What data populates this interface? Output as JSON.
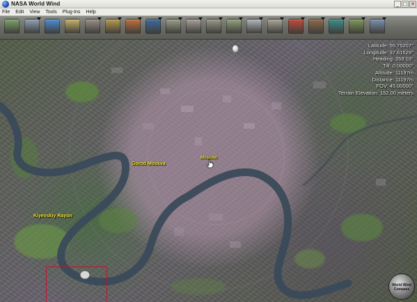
{
  "window": {
    "title": "NASA World Wind",
    "minimize_glyph": "_",
    "maximize_glyph": "▢",
    "close_glyph": "✕"
  },
  "menu": [
    "File",
    "Edit",
    "View",
    "Tools",
    "Plug-Ins",
    "Help"
  ],
  "toolbar": {
    "buttons": [
      {
        "name": "satellite-tool-icon",
        "color": "#7da36b"
      },
      {
        "name": "grid-tool-icon",
        "color": "#8fa1b6"
      },
      {
        "name": "globe-tool-icon",
        "color": "#4c8cd8"
      },
      {
        "name": "search-tool-icon",
        "color": "#c7b36a"
      },
      {
        "name": "layer-manager-icon",
        "color": "#9a8f86"
      },
      {
        "name": "landsat-layer-icon",
        "color": "#b89a4e"
      },
      {
        "name": "weather-layer-icon",
        "color": "#c0713a"
      },
      {
        "name": "bluemarble-layer-icon",
        "color": "#3e6a9e"
      },
      {
        "name": "usgs-topo-icon",
        "color": "#9aa08a"
      },
      {
        "name": "usgs-urban-icon",
        "color": "#a8a298"
      },
      {
        "name": "usgs-ortho-icon",
        "color": "#9c9a8c"
      },
      {
        "name": "zoomit-layer-icon",
        "color": "#93a37b"
      },
      {
        "name": "places-layer-icon",
        "color": "#b0b6bd"
      },
      {
        "name": "boundaries-layer-icon",
        "color": "#aaa69a"
      },
      {
        "name": "flag-layer-icon",
        "color": "#c24a3a"
      },
      {
        "name": "landmarks-layer-icon",
        "color": "#8f6a4a"
      },
      {
        "name": "atmosphere-layer-icon",
        "color": "#3b8f8a"
      },
      {
        "name": "terrain-layer-icon",
        "color": "#7f9a5a"
      },
      {
        "name": "scale-bar-icon",
        "color": "#7a90b0"
      }
    ]
  },
  "overlay": {
    "latitude": "Latitude: 55.75207°",
    "longitude": "Longitude: 37.61529°",
    "heading": "Heading: 359.03°",
    "tilt": "Tilt: 0.00000°",
    "altitude": "Altitude: 11197m",
    "distance": "Distance: 11197m",
    "fov": "FOV: 45.00000°",
    "terrain_elevation": "Terrain Elevation: 152.00 meters"
  },
  "labels": {
    "city": "Gorod Moskva",
    "poi": "Moscow",
    "district": "Kiyevskiy Rayon"
  },
  "compass": {
    "line1": "World Wind",
    "line2": "Compass"
  },
  "colors": {
    "label": "#ffef3a",
    "river": "#3a4a5a",
    "marker_box": "#c8102e"
  }
}
